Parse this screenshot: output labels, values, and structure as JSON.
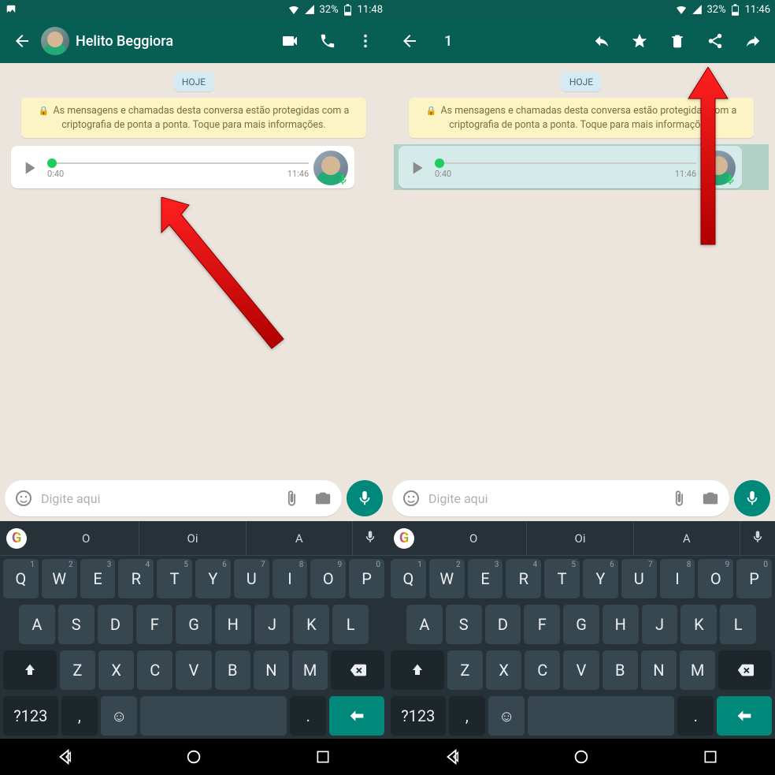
{
  "left": {
    "status": {
      "battery": "32%",
      "time": "11:48"
    },
    "appbar": {
      "title": "Helito Beggiora"
    },
    "chat": {
      "date_label": "HOJE",
      "encryption": "As mensagens e chamadas desta conversa estão protegidas com a criptografia de ponta a ponta. Toque para mais informações.",
      "voice": {
        "elapsed": "0:40",
        "timestamp": "11:46"
      }
    },
    "compose": {
      "placeholder": "Digite aqui"
    }
  },
  "right": {
    "status": {
      "battery": "32%",
      "time": "11:46"
    },
    "appbar": {
      "selected_count": "1"
    },
    "chat": {
      "date_label": "HOJE",
      "encryption": "As mensagens e chamadas desta conversa estão protegidas com a criptografia de ponta a ponta. Toque para mais informações.",
      "voice": {
        "elapsed": "0:40",
        "timestamp": "11:46"
      }
    },
    "compose": {
      "placeholder": "Digite aqui"
    }
  },
  "keyboard": {
    "suggestions": [
      "O",
      "Oi",
      "A"
    ],
    "row1": [
      {
        "k": "Q",
        "s": "1"
      },
      {
        "k": "W",
        "s": "2"
      },
      {
        "k": "E",
        "s": "3"
      },
      {
        "k": "R",
        "s": "4"
      },
      {
        "k": "T",
        "s": "5"
      },
      {
        "k": "Y",
        "s": "6"
      },
      {
        "k": "U",
        "s": "7"
      },
      {
        "k": "I",
        "s": "8"
      },
      {
        "k": "O",
        "s": "9"
      },
      {
        "k": "P",
        "s": "0"
      }
    ],
    "row2": [
      "A",
      "S",
      "D",
      "F",
      "G",
      "H",
      "J",
      "K",
      "L"
    ],
    "row3": [
      "Z",
      "X",
      "C",
      "V",
      "B",
      "N",
      "M"
    ],
    "sym_label": "?123"
  }
}
